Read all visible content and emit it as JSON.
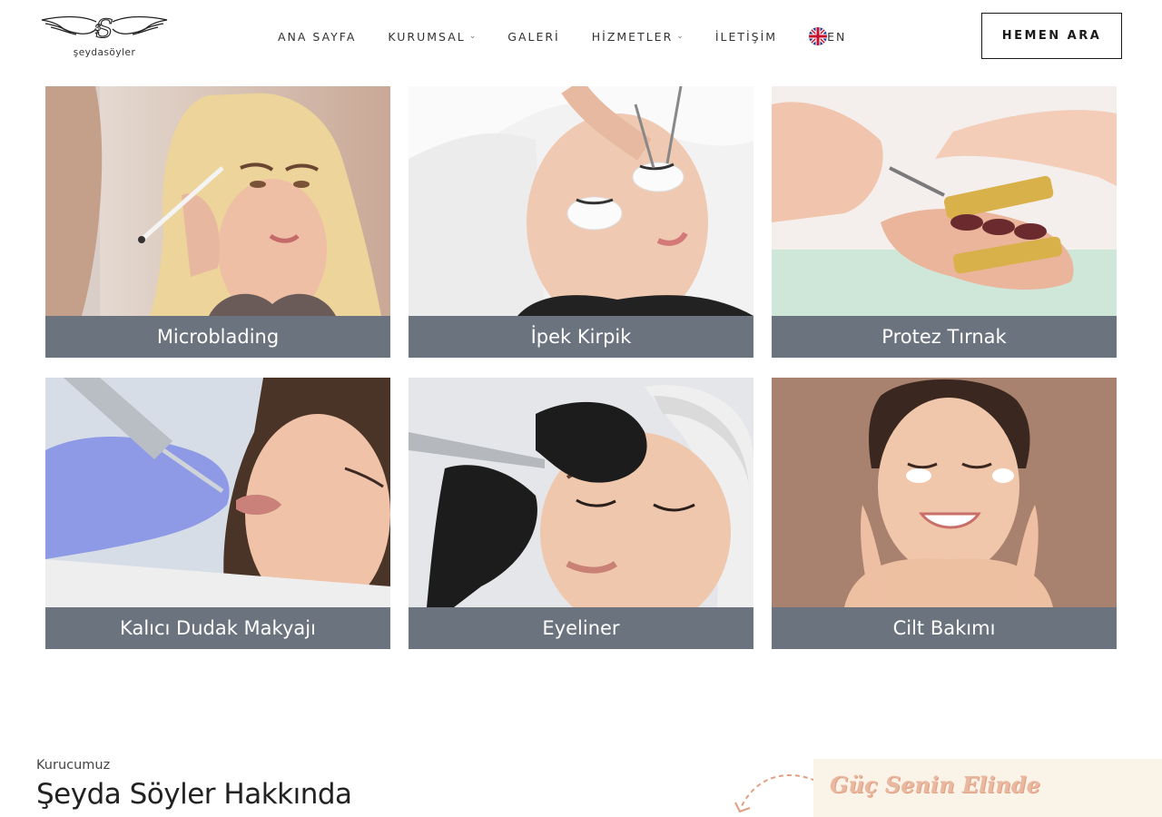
{
  "header": {
    "logo_text": "şeydasöyler",
    "nav": [
      {
        "label": "ANA SAYFA",
        "dropdown": false
      },
      {
        "label": "KURUMSAL",
        "dropdown": true
      },
      {
        "label": "GALERİ",
        "dropdown": false
      },
      {
        "label": "HİZMETLER",
        "dropdown": true
      },
      {
        "label": "İLETİŞİM",
        "dropdown": false
      }
    ],
    "language": "EN",
    "language_icon": "uk-flag-icon",
    "cta_label": "HEMEN ARA"
  },
  "services": [
    {
      "label": "Microblading",
      "image": "microblading-photo"
    },
    {
      "label": "İpek Kirpik",
      "image": "eyelash-extension-photo"
    },
    {
      "label": "Protez Tırnak",
      "image": "nail-extension-photo"
    },
    {
      "label": "Kalıcı Dudak Makyajı",
      "image": "permanent-lip-makeup-photo"
    },
    {
      "label": "Eyeliner",
      "image": "permanent-eyeliner-photo"
    },
    {
      "label": "Cilt Bakımı",
      "image": "skin-care-photo"
    }
  ],
  "about": {
    "kicker": "Kurucumuz",
    "title": "Şeyda Söyler Hakkında"
  },
  "banner": {
    "text": "Güç Senin Elinde"
  },
  "colors": {
    "caption_bg": "#6b737e",
    "banner_bg": "#faf3e8",
    "banner_text": "#e8b8a0",
    "arrow": "#e39e82"
  }
}
